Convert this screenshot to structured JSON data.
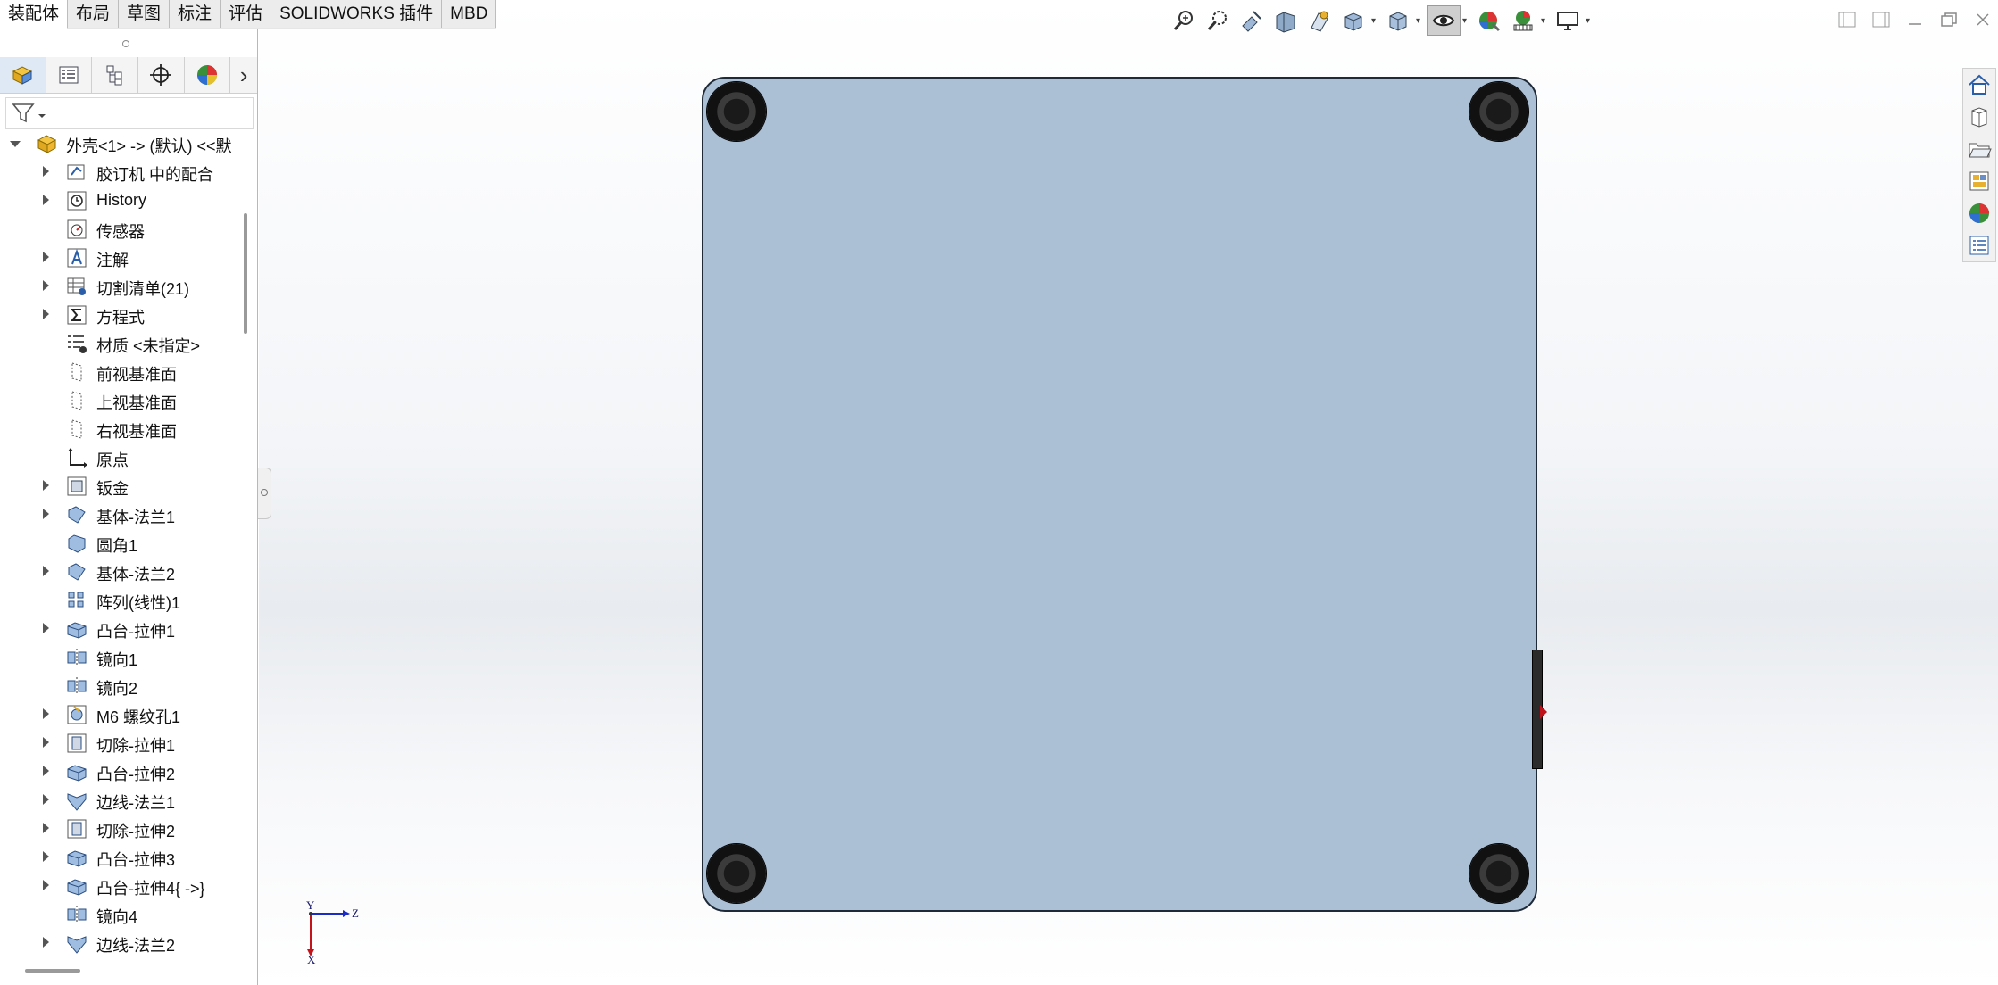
{
  "command_tabs": [
    "装配体",
    "布局",
    "草图",
    "标注",
    "评估",
    "SOLIDWORKS 插件",
    "MBD"
  ],
  "active_tab_index": 0,
  "feature_manager": {
    "root": "外壳<1> -> (默认) <<默",
    "items": [
      {
        "label": "胶订机 中的配合",
        "icon": "mates-icon",
        "expandable": true
      },
      {
        "label": "History",
        "icon": "history-icon",
        "expandable": true
      },
      {
        "label": "传感器",
        "icon": "sensor-icon",
        "expandable": false
      },
      {
        "label": "注解",
        "icon": "annotation-icon",
        "expandable": true
      },
      {
        "label": "切割清单(21)",
        "icon": "cutlist-icon",
        "expandable": true
      },
      {
        "label": "方程式",
        "icon": "equation-icon",
        "expandable": true
      },
      {
        "label": "材质 <未指定>",
        "icon": "material-icon",
        "expandable": false
      },
      {
        "label": "前视基准面",
        "icon": "plane-icon",
        "expandable": false
      },
      {
        "label": "上视基准面",
        "icon": "plane-icon",
        "expandable": false
      },
      {
        "label": "右视基准面",
        "icon": "plane-icon",
        "expandable": false
      },
      {
        "label": "原点",
        "icon": "origin-icon",
        "expandable": false
      },
      {
        "label": "钣金",
        "icon": "sheetmetal-icon",
        "expandable": true
      },
      {
        "label": "基体-法兰1",
        "icon": "base-flange-icon",
        "expandable": true
      },
      {
        "label": "圆角1",
        "icon": "fillet-icon",
        "expandable": false
      },
      {
        "label": "基体-法兰2",
        "icon": "base-flange-icon",
        "expandable": true
      },
      {
        "label": "阵列(线性)1",
        "icon": "linear-pattern-icon",
        "expandable": false
      },
      {
        "label": "凸台-拉伸1",
        "icon": "boss-extrude-icon",
        "expandable": true
      },
      {
        "label": "镜向1",
        "icon": "mirror-icon",
        "expandable": false
      },
      {
        "label": "镜向2",
        "icon": "mirror-icon",
        "expandable": false
      },
      {
        "label": "M6 螺纹孔1",
        "icon": "hole-icon",
        "expandable": true
      },
      {
        "label": "切除-拉伸1",
        "icon": "cut-extrude-icon",
        "expandable": true
      },
      {
        "label": "凸台-拉伸2",
        "icon": "boss-extrude-icon",
        "expandable": true
      },
      {
        "label": "边线-法兰1",
        "icon": "edge-flange-icon",
        "expandable": true
      },
      {
        "label": "切除-拉伸2",
        "icon": "cut-extrude-icon",
        "expandable": true
      },
      {
        "label": "凸台-拉伸3",
        "icon": "boss-extrude-icon",
        "expandable": true
      },
      {
        "label": "凸台-拉伸4{ ->}",
        "icon": "boss-extrude-icon",
        "expandable": true
      },
      {
        "label": "镜向4",
        "icon": "mirror-icon",
        "expandable": false
      },
      {
        "label": "边线-法兰2",
        "icon": "edge-flange-icon",
        "expandable": true
      }
    ]
  },
  "triad": {
    "x": "X",
    "y": "Y",
    "z": "Z"
  },
  "colors": {
    "part_face": "#abbfd5",
    "part_edge": "#1e2a38",
    "foot": "#1a1a1a"
  }
}
